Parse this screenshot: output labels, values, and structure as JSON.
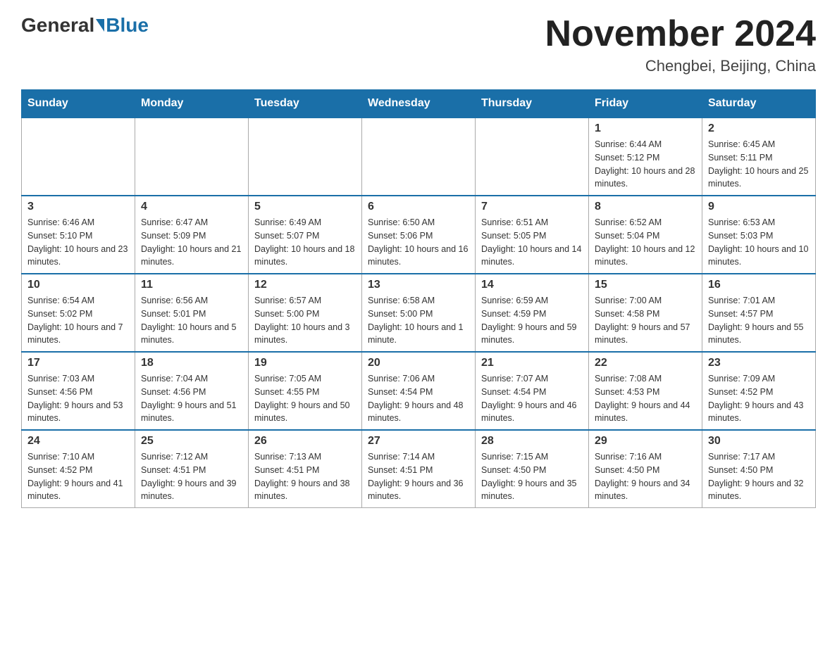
{
  "header": {
    "logo_general": "General",
    "logo_blue": "Blue",
    "month_title": "November 2024",
    "location": "Chengbei, Beijing, China"
  },
  "weekdays": [
    "Sunday",
    "Monday",
    "Tuesday",
    "Wednesday",
    "Thursday",
    "Friday",
    "Saturday"
  ],
  "weeks": [
    [
      {
        "day": "",
        "info": ""
      },
      {
        "day": "",
        "info": ""
      },
      {
        "day": "",
        "info": ""
      },
      {
        "day": "",
        "info": ""
      },
      {
        "day": "",
        "info": ""
      },
      {
        "day": "1",
        "info": "Sunrise: 6:44 AM\nSunset: 5:12 PM\nDaylight: 10 hours and 28 minutes."
      },
      {
        "day": "2",
        "info": "Sunrise: 6:45 AM\nSunset: 5:11 PM\nDaylight: 10 hours and 25 minutes."
      }
    ],
    [
      {
        "day": "3",
        "info": "Sunrise: 6:46 AM\nSunset: 5:10 PM\nDaylight: 10 hours and 23 minutes."
      },
      {
        "day": "4",
        "info": "Sunrise: 6:47 AM\nSunset: 5:09 PM\nDaylight: 10 hours and 21 minutes."
      },
      {
        "day": "5",
        "info": "Sunrise: 6:49 AM\nSunset: 5:07 PM\nDaylight: 10 hours and 18 minutes."
      },
      {
        "day": "6",
        "info": "Sunrise: 6:50 AM\nSunset: 5:06 PM\nDaylight: 10 hours and 16 minutes."
      },
      {
        "day": "7",
        "info": "Sunrise: 6:51 AM\nSunset: 5:05 PM\nDaylight: 10 hours and 14 minutes."
      },
      {
        "day": "8",
        "info": "Sunrise: 6:52 AM\nSunset: 5:04 PM\nDaylight: 10 hours and 12 minutes."
      },
      {
        "day": "9",
        "info": "Sunrise: 6:53 AM\nSunset: 5:03 PM\nDaylight: 10 hours and 10 minutes."
      }
    ],
    [
      {
        "day": "10",
        "info": "Sunrise: 6:54 AM\nSunset: 5:02 PM\nDaylight: 10 hours and 7 minutes."
      },
      {
        "day": "11",
        "info": "Sunrise: 6:56 AM\nSunset: 5:01 PM\nDaylight: 10 hours and 5 minutes."
      },
      {
        "day": "12",
        "info": "Sunrise: 6:57 AM\nSunset: 5:00 PM\nDaylight: 10 hours and 3 minutes."
      },
      {
        "day": "13",
        "info": "Sunrise: 6:58 AM\nSunset: 5:00 PM\nDaylight: 10 hours and 1 minute."
      },
      {
        "day": "14",
        "info": "Sunrise: 6:59 AM\nSunset: 4:59 PM\nDaylight: 9 hours and 59 minutes."
      },
      {
        "day": "15",
        "info": "Sunrise: 7:00 AM\nSunset: 4:58 PM\nDaylight: 9 hours and 57 minutes."
      },
      {
        "day": "16",
        "info": "Sunrise: 7:01 AM\nSunset: 4:57 PM\nDaylight: 9 hours and 55 minutes."
      }
    ],
    [
      {
        "day": "17",
        "info": "Sunrise: 7:03 AM\nSunset: 4:56 PM\nDaylight: 9 hours and 53 minutes."
      },
      {
        "day": "18",
        "info": "Sunrise: 7:04 AM\nSunset: 4:56 PM\nDaylight: 9 hours and 51 minutes."
      },
      {
        "day": "19",
        "info": "Sunrise: 7:05 AM\nSunset: 4:55 PM\nDaylight: 9 hours and 50 minutes."
      },
      {
        "day": "20",
        "info": "Sunrise: 7:06 AM\nSunset: 4:54 PM\nDaylight: 9 hours and 48 minutes."
      },
      {
        "day": "21",
        "info": "Sunrise: 7:07 AM\nSunset: 4:54 PM\nDaylight: 9 hours and 46 minutes."
      },
      {
        "day": "22",
        "info": "Sunrise: 7:08 AM\nSunset: 4:53 PM\nDaylight: 9 hours and 44 minutes."
      },
      {
        "day": "23",
        "info": "Sunrise: 7:09 AM\nSunset: 4:52 PM\nDaylight: 9 hours and 43 minutes."
      }
    ],
    [
      {
        "day": "24",
        "info": "Sunrise: 7:10 AM\nSunset: 4:52 PM\nDaylight: 9 hours and 41 minutes."
      },
      {
        "day": "25",
        "info": "Sunrise: 7:12 AM\nSunset: 4:51 PM\nDaylight: 9 hours and 39 minutes."
      },
      {
        "day": "26",
        "info": "Sunrise: 7:13 AM\nSunset: 4:51 PM\nDaylight: 9 hours and 38 minutes."
      },
      {
        "day": "27",
        "info": "Sunrise: 7:14 AM\nSunset: 4:51 PM\nDaylight: 9 hours and 36 minutes."
      },
      {
        "day": "28",
        "info": "Sunrise: 7:15 AM\nSunset: 4:50 PM\nDaylight: 9 hours and 35 minutes."
      },
      {
        "day": "29",
        "info": "Sunrise: 7:16 AM\nSunset: 4:50 PM\nDaylight: 9 hours and 34 minutes."
      },
      {
        "day": "30",
        "info": "Sunrise: 7:17 AM\nSunset: 4:50 PM\nDaylight: 9 hours and 32 minutes."
      }
    ]
  ]
}
